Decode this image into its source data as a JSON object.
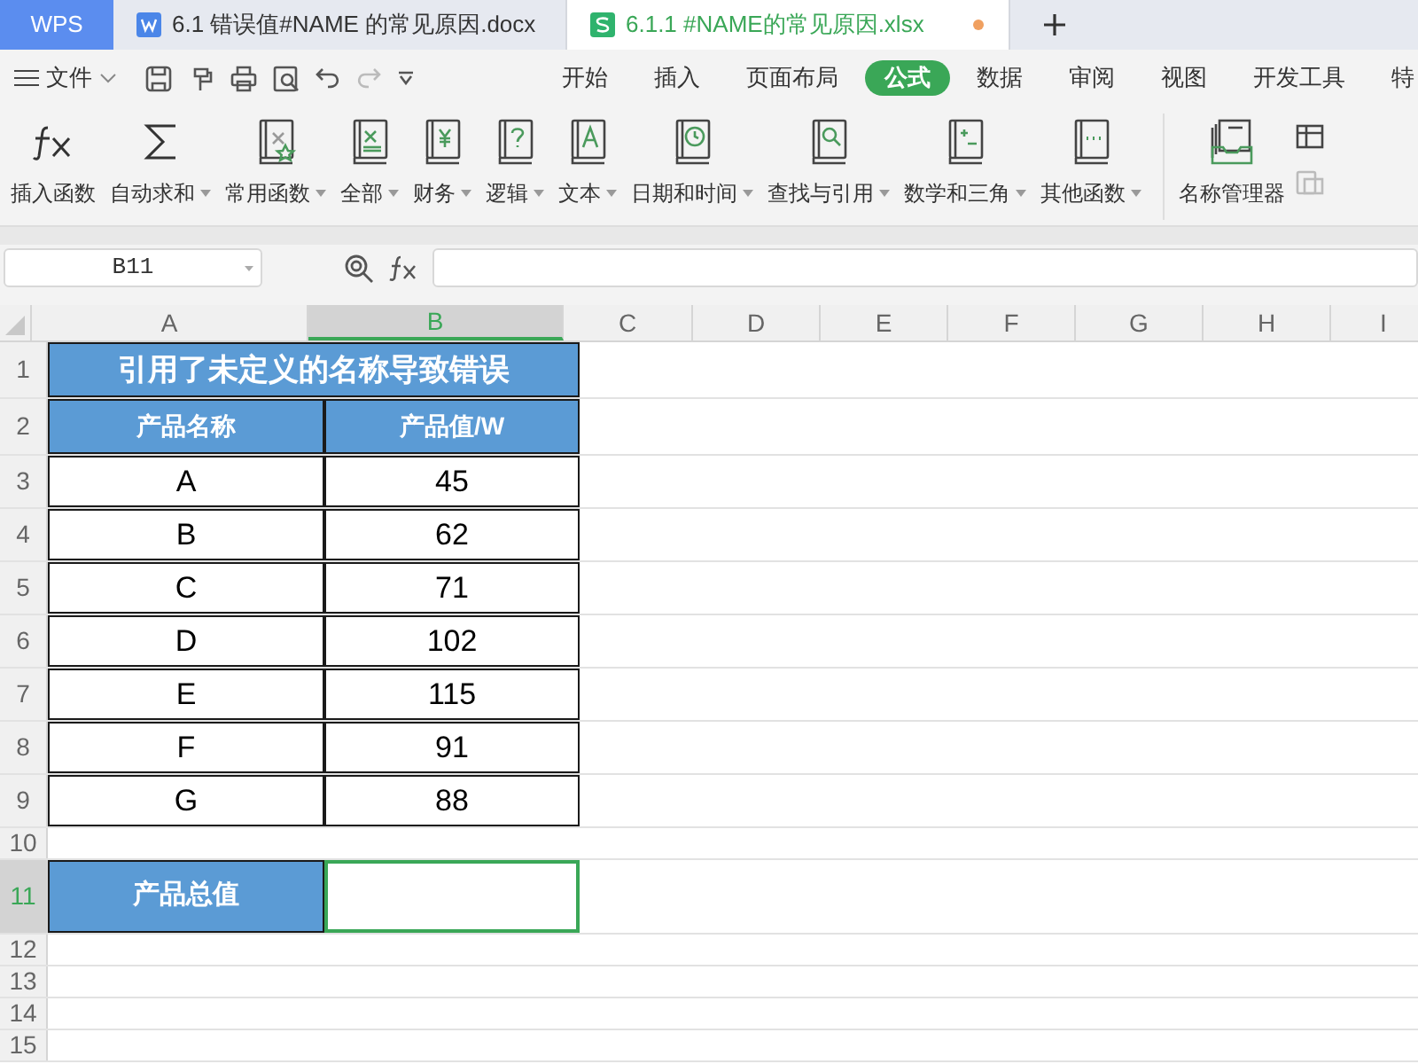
{
  "tabs": [
    {
      "kind": "home",
      "label": "WPS",
      "selected": false
    },
    {
      "kind": "doc",
      "label": "6.1 错误值#NAME 的常见原因.docx",
      "selected": false
    },
    {
      "kind": "sheet",
      "label": "6.1.1 #NAME的常见原因.xlsx",
      "selected": true,
      "unsaved": true
    }
  ],
  "file_menu": "文件",
  "menu": [
    {
      "label": "开始",
      "selected": false
    },
    {
      "label": "插入",
      "selected": false
    },
    {
      "label": "页面布局",
      "selected": false
    },
    {
      "label": "公式",
      "selected": true
    },
    {
      "label": "数据",
      "selected": false
    },
    {
      "label": "审阅",
      "selected": false
    },
    {
      "label": "视图",
      "selected": false
    },
    {
      "label": "开发工具",
      "selected": false
    },
    {
      "label": "特",
      "selected": false
    }
  ],
  "ribbon": [
    {
      "label": "插入函数",
      "dropdown": false
    },
    {
      "label": "自动求和",
      "dropdown": true
    },
    {
      "label": "常用函数",
      "dropdown": true
    },
    {
      "label": "全部",
      "dropdown": true
    },
    {
      "label": "财务",
      "dropdown": true
    },
    {
      "label": "逻辑",
      "dropdown": true
    },
    {
      "label": "文本",
      "dropdown": true
    },
    {
      "label": "日期和时间",
      "dropdown": true
    },
    {
      "label": "查找与引用",
      "dropdown": true
    },
    {
      "label": "数学和三角",
      "dropdown": true
    },
    {
      "label": "其他函数",
      "dropdown": true
    },
    {
      "label": "名称管理器",
      "dropdown": false
    }
  ],
  "name_box": "B11",
  "columns": [
    {
      "label": "A",
      "selected": false
    },
    {
      "label": "B",
      "selected": true
    },
    {
      "label": "C",
      "selected": false
    },
    {
      "label": "D",
      "selected": false
    },
    {
      "label": "E",
      "selected": false
    },
    {
      "label": "F",
      "selected": false
    },
    {
      "label": "G",
      "selected": false
    },
    {
      "label": "H",
      "selected": false
    },
    {
      "label": "I",
      "selected": false
    }
  ],
  "rows": [
    {
      "number": "1",
      "kind": "title",
      "selected": false,
      "cells": [
        "引用了未定义的名称导致错误"
      ]
    },
    {
      "number": "2",
      "kind": "header",
      "selected": false,
      "cells": [
        "产品名称",
        "产品值/W"
      ]
    },
    {
      "number": "3",
      "kind": "data",
      "selected": false,
      "cells": [
        "A",
        "45"
      ]
    },
    {
      "number": "4",
      "kind": "data",
      "selected": false,
      "cells": [
        "B",
        "62"
      ]
    },
    {
      "number": "5",
      "kind": "data",
      "selected": false,
      "cells": [
        "C",
        "71"
      ]
    },
    {
      "number": "6",
      "kind": "data",
      "selected": false,
      "cells": [
        "D",
        "102"
      ]
    },
    {
      "number": "7",
      "kind": "data",
      "selected": false,
      "cells": [
        "E",
        "115"
      ]
    },
    {
      "number": "8",
      "kind": "data",
      "selected": false,
      "cells": [
        "F",
        "91"
      ]
    },
    {
      "number": "9",
      "kind": "data",
      "selected": false,
      "cells": [
        "G",
        "88"
      ]
    },
    {
      "number": "10",
      "kind": "blank",
      "selected": false,
      "cells": []
    },
    {
      "number": "11",
      "kind": "total",
      "selected": true,
      "cells": [
        "产品总值",
        ""
      ]
    },
    {
      "number": "12",
      "kind": "blank",
      "selected": false,
      "cells": []
    },
    {
      "number": "13",
      "kind": "blank",
      "selected": false,
      "cells": []
    },
    {
      "number": "14",
      "kind": "blank",
      "selected": false,
      "cells": []
    },
    {
      "number": "15",
      "kind": "blank",
      "selected": false,
      "cells": []
    }
  ]
}
